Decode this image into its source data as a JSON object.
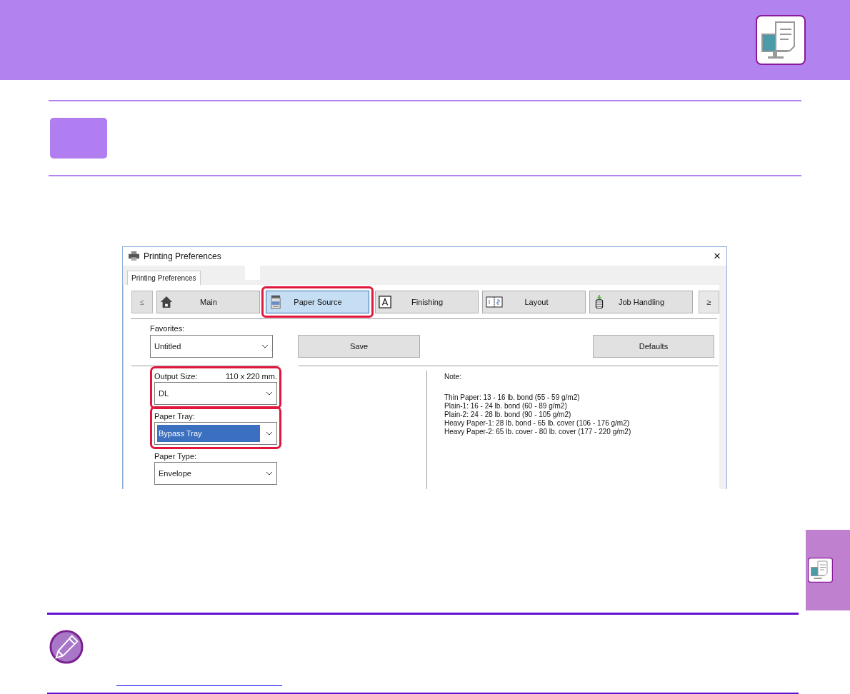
{
  "dialog": {
    "title": "Printing Preferences",
    "close": "×",
    "tabs": [
      {
        "label": "Printing Preferences",
        "selected": true
      }
    ],
    "nav_prev": "≤",
    "nav_next": "≥",
    "nav": [
      {
        "label": "Main",
        "kind": "home",
        "selected": false,
        "highlighted": false
      },
      {
        "label": "Paper Source",
        "kind": "printer",
        "selected": true,
        "highlighted": true
      },
      {
        "label": "Finishing",
        "kind": "letter",
        "selected": false,
        "highlighted": false
      },
      {
        "label": "Layout",
        "kind": "pages",
        "selected": false,
        "highlighted": false
      },
      {
        "label": "Job Handling",
        "kind": "stack",
        "selected": false,
        "highlighted": false
      }
    ],
    "favorites": {
      "label": "Favorites:",
      "value": "Untitled"
    },
    "save": "Save",
    "defaults": "Defaults",
    "fields": [
      {
        "label": "Output Size:",
        "info": "110 x 220 mm.",
        "value": "DL",
        "highlighted": true,
        "focused": false
      },
      {
        "label": "Paper Tray:",
        "value": "Bypass Tray",
        "highlighted": true,
        "focused": true
      },
      {
        "label": "Paper Type:",
        "value": "Envelope",
        "highlighted": false,
        "focused": false
      }
    ],
    "note": {
      "title": "Note:",
      "lines": [
        "Thin Paper: 13 - 16 lb. bond (55 - 59 g/m2)",
        "Plain-1: 16 - 24 lb. bond (60 - 89 g/m2)",
        "Plain-2: 24 - 28 lb. bond (90 - 105 g/m2)",
        "Heavy Paper-1: 28 lb. bond - 65 lb. cover (106 - 176 g/m2)",
        "Heavy Paper-2: 65 lb. cover - 80 lb. cover (177 - 220 g/m2)"
      ]
    }
  }
}
